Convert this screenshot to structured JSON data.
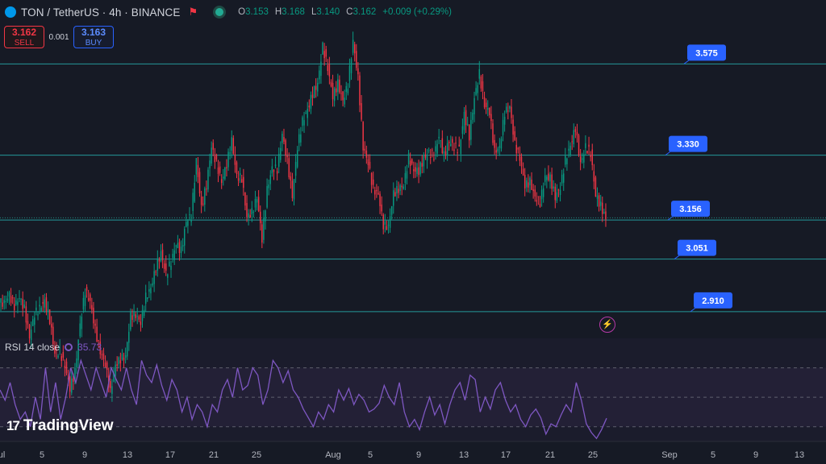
{
  "header": {
    "symbol": "TON / TetherUS · 4h · BINANCE",
    "open_label": "O",
    "open": "3.153",
    "high_label": "H",
    "high": "3.168",
    "low_label": "L",
    "low": "3.140",
    "close_label": "C",
    "close": "3.162",
    "change": "+0.009 (+0.29%)"
  },
  "trade": {
    "sell_price": "3.162",
    "sell_label": "SELL",
    "spread": "0.001",
    "buy_price": "3.163",
    "buy_label": "BUY"
  },
  "rsi": {
    "label": "RSI 14 close",
    "value": "35.73"
  },
  "branding": {
    "logo_text": "TradingView"
  },
  "colors": {
    "up": "#089981",
    "down": "#f23645",
    "level": "#26a6a6",
    "tag": "#2962ff",
    "rsi": "#7e57c2",
    "bg": "#161a25"
  },
  "chart_data": [
    {
      "type": "candlestick",
      "ylim": [
        2.86,
        3.66
      ],
      "x_ticks": [
        "ul",
        "5",
        "9",
        "13",
        "17",
        "21",
        "25",
        "Aug",
        "5",
        "9",
        "13",
        "17",
        "21",
        "25",
        "Sep",
        "5",
        "9",
        "13"
      ],
      "levels": [
        {
          "value": 3.575,
          "label": "3.575"
        },
        {
          "value": 3.33,
          "label": "3.330"
        },
        {
          "value": 3.156,
          "label": "3.156"
        },
        {
          "value": 3.051,
          "label": "3.051"
        },
        {
          "value": 2.91,
          "label": "2.910"
        }
      ],
      "path": [
        [
          0,
          2.92
        ],
        [
          2,
          2.96
        ],
        [
          5,
          2.87
        ],
        [
          8,
          2.94
        ],
        [
          10,
          2.82
        ],
        [
          12,
          2.75
        ],
        [
          14,
          2.73
        ],
        [
          16,
          2.99
        ],
        [
          19,
          2.8
        ],
        [
          21,
          2.72
        ],
        [
          23,
          2.77
        ],
        [
          25,
          2.88
        ],
        [
          27,
          2.9
        ],
        [
          29,
          2.98
        ],
        [
          31,
          3.06
        ],
        [
          33,
          3.02
        ],
        [
          34,
          3.08
        ],
        [
          37,
          3.16
        ],
        [
          38,
          3.33
        ],
        [
          39,
          3.18
        ],
        [
          40,
          3.26
        ],
        [
          41,
          3.34
        ],
        [
          42,
          3.3
        ],
        [
          44,
          3.28
        ],
        [
          45,
          3.36
        ],
        [
          47,
          3.25
        ],
        [
          48,
          3.16
        ],
        [
          50,
          3.21
        ],
        [
          51,
          3.12
        ],
        [
          52,
          3.22
        ],
        [
          53,
          3.29
        ],
        [
          55,
          3.36
        ],
        [
          57,
          3.25
        ],
        [
          59,
          3.42
        ],
        [
          61,
          3.49
        ],
        [
          62,
          3.54
        ],
        [
          63,
          3.6
        ],
        [
          65,
          3.52
        ],
        [
          67,
          3.47
        ],
        [
          69,
          3.62
        ],
        [
          70,
          3.54
        ],
        [
          71,
          3.35
        ],
        [
          73,
          3.26
        ],
        [
          75,
          3.14
        ],
        [
          77,
          3.2
        ],
        [
          79,
          3.27
        ],
        [
          80,
          3.31
        ],
        [
          82,
          3.28
        ],
        [
          84,
          3.36
        ],
        [
          85,
          3.3
        ],
        [
          86,
          3.38
        ],
        [
          88,
          3.34
        ],
        [
          90,
          3.36
        ],
        [
          91,
          3.43
        ],
        [
          92,
          3.39
        ],
        [
          94,
          3.55
        ],
        [
          95,
          3.49
        ],
        [
          97,
          3.34
        ],
        [
          99,
          3.42
        ],
        [
          100,
          3.46
        ],
        [
          101,
          3.37
        ],
        [
          103,
          3.26
        ],
        [
          105,
          3.22
        ],
        [
          107,
          3.24
        ],
        [
          108,
          3.27
        ],
        [
          110,
          3.22
        ],
        [
          111,
          3.32
        ],
        [
          113,
          3.4
        ],
        [
          114,
          3.32
        ],
        [
          116,
          3.34
        ],
        [
          117,
          3.25
        ],
        [
          118,
          3.16
        ],
        [
          119,
          3.163
        ]
      ],
      "total_bars": 120
    },
    {
      "type": "line",
      "name": "RSI 14 close",
      "ylim": [
        20,
        90
      ],
      "bands": [
        70,
        50,
        30
      ],
      "values": [
        55,
        48,
        60,
        45,
        35,
        40,
        30,
        50,
        35,
        70,
        40,
        60,
        35,
        50,
        70,
        60,
        75,
        65,
        55,
        70,
        60,
        50,
        70,
        62,
        55,
        70,
        55,
        45,
        75,
        65,
        60,
        72,
        58,
        48,
        62,
        55,
        40,
        50,
        35,
        45,
        40,
        30,
        45,
        40,
        55,
        62,
        50,
        70,
        55,
        58,
        70,
        65,
        45,
        55,
        75,
        70,
        60,
        68,
        55,
        50,
        42,
        36,
        30,
        40,
        35,
        45,
        40,
        55,
        48,
        56,
        45,
        52,
        48,
        40,
        42,
        46,
        58,
        50,
        45,
        60,
        40,
        30,
        35,
        28,
        40,
        50,
        38,
        45,
        32,
        45,
        55,
        60,
        48,
        65,
        62,
        40,
        50,
        42,
        55,
        60,
        48,
        40,
        45,
        35,
        30,
        38,
        42,
        36,
        25,
        32,
        30,
        38,
        45,
        40,
        60,
        48,
        32,
        26,
        22,
        28,
        35.73
      ]
    }
  ]
}
